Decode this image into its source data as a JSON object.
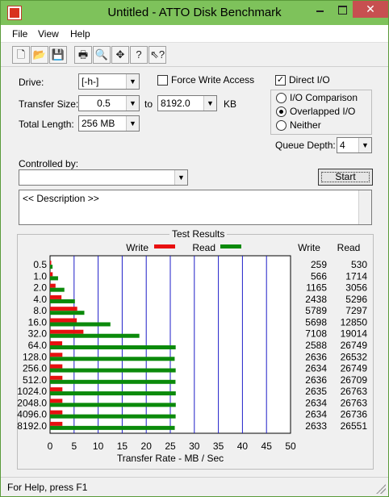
{
  "window": {
    "title": "Untitled - ATTO Disk Benchmark",
    "close_glyph": "✕"
  },
  "menu": {
    "file": "File",
    "view": "View",
    "help": "Help"
  },
  "toolbar": {
    "new_icon": "new-document-icon",
    "open_icon": "open-folder-icon",
    "save_icon": "save-disk-icon",
    "print_icon": "printer-icon",
    "preview_icon": "print-preview-icon",
    "move_icon": "move-arrows-icon",
    "help_icon": "help-question-icon",
    "context_help_icon": "context-help-icon"
  },
  "settings": {
    "drive_label": "Drive:",
    "drive_value": "[-h-]",
    "force_write_label": "Force Write Access",
    "force_write_checked": false,
    "direct_io_label": "Direct I/O",
    "direct_io_checked": true,
    "transfer_size_label": "Transfer Size:",
    "transfer_from": "0.5",
    "to_label": "to",
    "transfer_to": "8192.0",
    "kb_label": "KB",
    "total_length_label": "Total Length:",
    "total_length_value": "256 MB",
    "io_options": [
      "I/O Comparison",
      "Overlapped I/O",
      "Neither"
    ],
    "io_selected": "Overlapped I/O",
    "queue_depth_label": "Queue Depth:",
    "queue_depth_value": "4",
    "controlled_by_label": "Controlled by:",
    "controlled_by_value": "",
    "start_label": "Start",
    "description_value": "<< Description >>"
  },
  "chart_data": {
    "type": "bar",
    "title": "Test Results",
    "orientation": "horizontal",
    "xlabel": "Transfer Rate - MB / Sec",
    "xlim": [
      0,
      50
    ],
    "xticks": [
      0,
      5,
      10,
      15,
      20,
      25,
      30,
      35,
      40,
      45,
      50
    ],
    "grid": true,
    "legend_position": "top",
    "categories": [
      "0.5",
      "1.0",
      "2.0",
      "4.0",
      "8.0",
      "16.0",
      "32.0",
      "64.0",
      "128.0",
      "256.0",
      "512.0",
      "1024.0",
      "2048.0",
      "4096.0",
      "8192.0"
    ],
    "series": [
      {
        "name": "Write",
        "color": "#e81010",
        "values": [
          0.25,
          0.55,
          1.14,
          2.38,
          5.65,
          5.56,
          6.94,
          2.53,
          2.57,
          2.57,
          2.57,
          2.57,
          2.57,
          2.57,
          2.57
        ]
      },
      {
        "name": "Read",
        "color": "#0b8a0b",
        "values": [
          0.52,
          1.67,
          2.98,
          5.17,
          7.13,
          12.55,
          18.57,
          26.12,
          25.91,
          26.12,
          26.08,
          26.14,
          26.14,
          26.11,
          25.93
        ]
      }
    ],
    "table_headers": [
      "Write",
      "Read"
    ],
    "table_rows": [
      [
        "259",
        "530"
      ],
      [
        "566",
        "1714"
      ],
      [
        "1165",
        "3056"
      ],
      [
        "2438",
        "5296"
      ],
      [
        "5789",
        "7297"
      ],
      [
        "5698",
        "12850"
      ],
      [
        "7108",
        "19014"
      ],
      [
        "2588",
        "26749"
      ],
      [
        "2636",
        "26532"
      ],
      [
        "2634",
        "26749"
      ],
      [
        "2636",
        "26709"
      ],
      [
        "2635",
        "26763"
      ],
      [
        "2634",
        "26763"
      ],
      [
        "2634",
        "26736"
      ],
      [
        "2633",
        "26551"
      ]
    ]
  },
  "status": {
    "text": "For Help, press F1"
  }
}
